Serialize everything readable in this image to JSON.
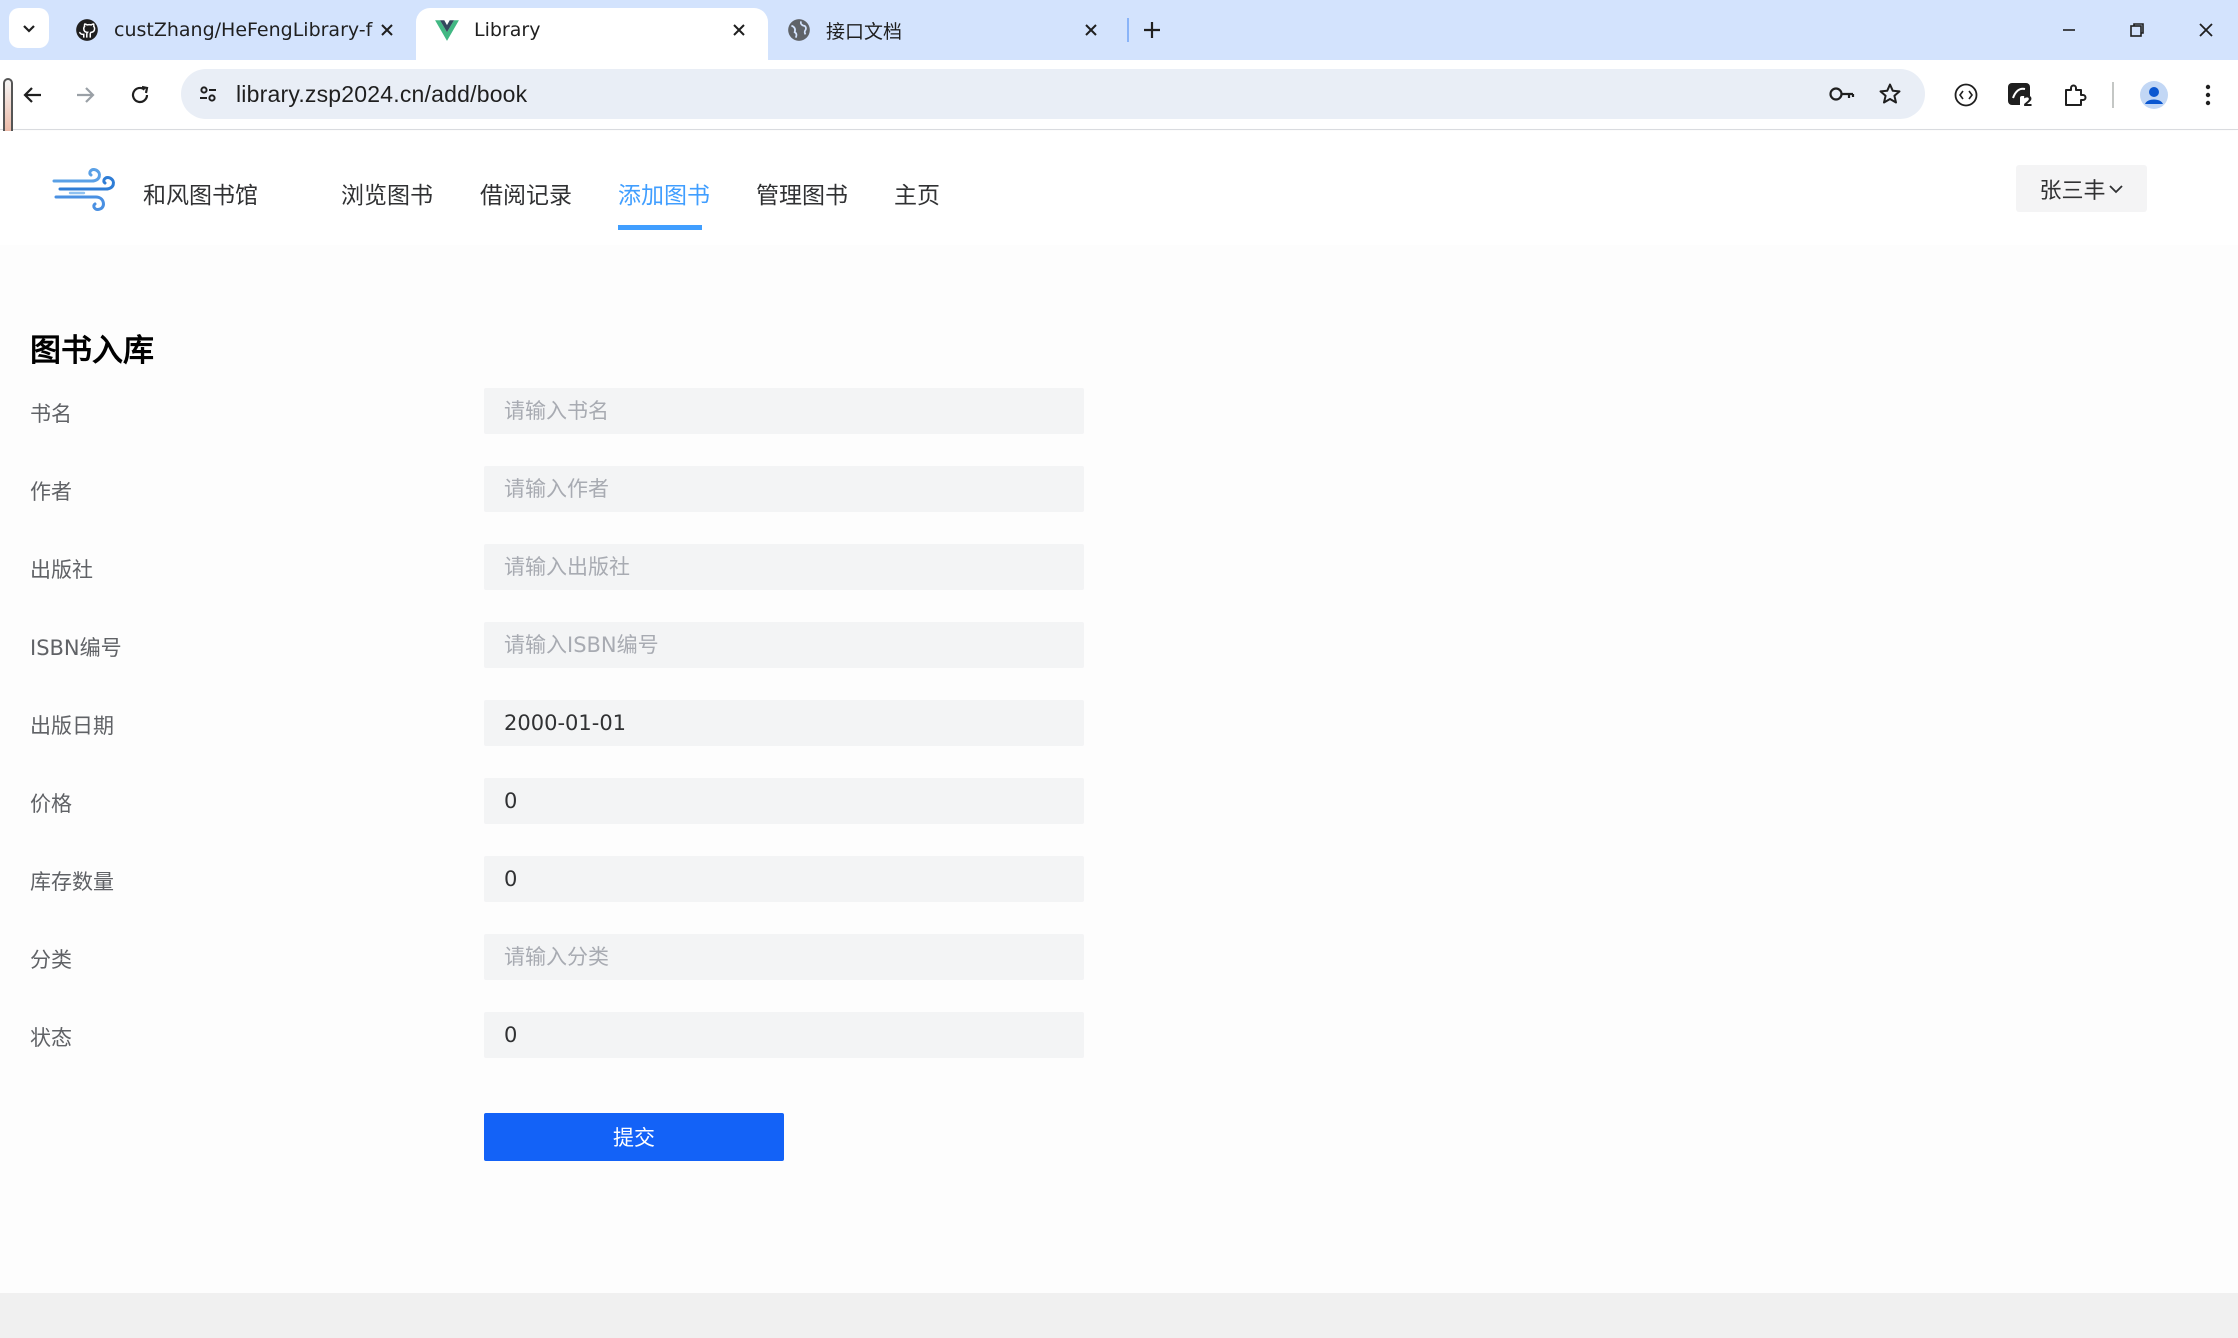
{
  "browser": {
    "tabs": [
      {
        "title": "custZhang/HeFengLibrary-fr",
        "icon": "github-icon",
        "active": false
      },
      {
        "title": "Library",
        "icon": "vue-icon",
        "active": true
      },
      {
        "title": "接口文档",
        "icon": "globe-icon",
        "active": false
      }
    ],
    "url": "library.zsp2024.cn/add/book",
    "profile_badge": "2",
    "colors": {
      "tabstrip": "#d3e3fd",
      "omnibox": "#e9eef6"
    }
  },
  "site": {
    "brand": "和风图书馆",
    "nav": [
      {
        "label": "浏览图书",
        "active": false
      },
      {
        "label": "借阅记录",
        "active": false
      },
      {
        "label": "添加图书",
        "active": true
      },
      {
        "label": "管理图书",
        "active": false
      },
      {
        "label": "主页",
        "active": false
      }
    ],
    "user": "张三丰",
    "accent_color": "#409eff"
  },
  "form": {
    "title": "图书入库",
    "fields": [
      {
        "label": "书名",
        "placeholder": "请输入书名",
        "value": ""
      },
      {
        "label": "作者",
        "placeholder": "请输入作者",
        "value": ""
      },
      {
        "label": "出版社",
        "placeholder": "请输入出版社",
        "value": ""
      },
      {
        "label": "ISBN编号",
        "placeholder": "请输入ISBN编号",
        "value": ""
      },
      {
        "label": "出版日期",
        "placeholder": "",
        "value": "2000-01-01"
      },
      {
        "label": "价格",
        "placeholder": "",
        "value": "0"
      },
      {
        "label": "库存数量",
        "placeholder": "",
        "value": "0"
      },
      {
        "label": "分类",
        "placeholder": "请输入分类",
        "value": ""
      },
      {
        "label": "状态",
        "placeholder": "",
        "value": "0"
      }
    ],
    "submit_label": "提交",
    "submit_color": "#1362f7"
  }
}
